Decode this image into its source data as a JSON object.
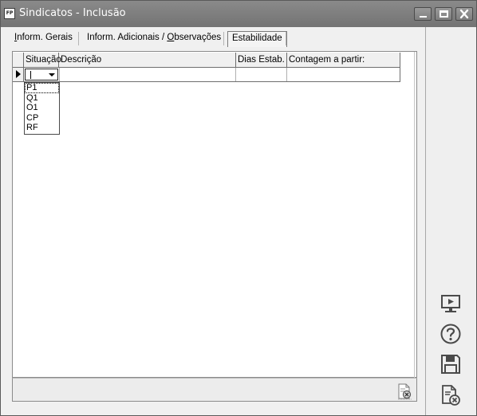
{
  "window": {
    "title": "Sindicatos - Inclusão",
    "app_icon_text": "FP",
    "minimize_icon": "minimize-icon",
    "maximize_icon": "maximize-icon",
    "close_icon": "close-icon"
  },
  "tabs": [
    {
      "label_ul": "I",
      "label_rest": "nform. Gerais",
      "active": false
    },
    {
      "label_pre": "Inform. Adicionais / ",
      "label_ul": "O",
      "label_rest": "bservações",
      "active": false
    },
    {
      "label": "Estabilidade",
      "active": true
    }
  ],
  "grid": {
    "columns": [
      "Situação",
      "Descrição",
      "Dias Estab.",
      "Contagem a partir:"
    ],
    "rows": [
      {
        "situacao": "",
        "descricao": "",
        "dias": "",
        "contagem": ""
      }
    ],
    "row_indicator_icon": "current-row-arrow-icon"
  },
  "dropdown": {
    "options": [
      "P1",
      "Q1",
      "O1",
      "CP",
      "RF"
    ],
    "highlighted": "P1",
    "arrow_icon": "dropdown-arrow-icon"
  },
  "sidebar": {
    "icons": [
      "preview-icon",
      "help-icon",
      "save-icon",
      "cancel-document-icon"
    ]
  },
  "status": {
    "icon": "delete-record-icon"
  },
  "colors": {
    "titlebar": "#7f7f7f",
    "background": "#f0f0f0",
    "panel": "#ffffff"
  }
}
